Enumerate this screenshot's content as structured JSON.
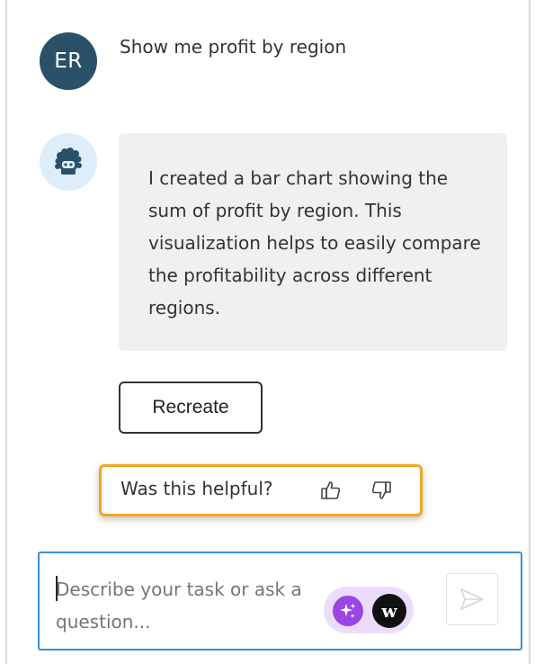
{
  "user_message": {
    "avatar_initials": "ER",
    "text": "Show me profit by region"
  },
  "bot_message": {
    "avatar_icon": "assistant-bot-icon",
    "text": "I created a bar chart showing the sum of profit by region. This visualization helps to easily compare the profitability across different regions."
  },
  "actions": {
    "recreate_label": "Recreate"
  },
  "feedback": {
    "question": "Was this helpful?",
    "thumbs_up_icon": "thumbs-up-icon",
    "thumbs_down_icon": "thumbs-down-icon",
    "highlight_color": "#f0a722"
  },
  "composer": {
    "placeholder": "Describe your task or ask a question...",
    "value": "",
    "ai_icon": "sparkle-icon",
    "w_icon_letter": "w",
    "send_icon": "send-icon",
    "border_color": "#3b8fd6"
  },
  "colors": {
    "user_avatar_bg": "#2b5168",
    "bot_avatar_bg": "#ddeefa",
    "bubble_bg": "#f0f0f0",
    "ai_icon_bg": "#9b45e4",
    "pill_bg": "#ecdcfb"
  }
}
